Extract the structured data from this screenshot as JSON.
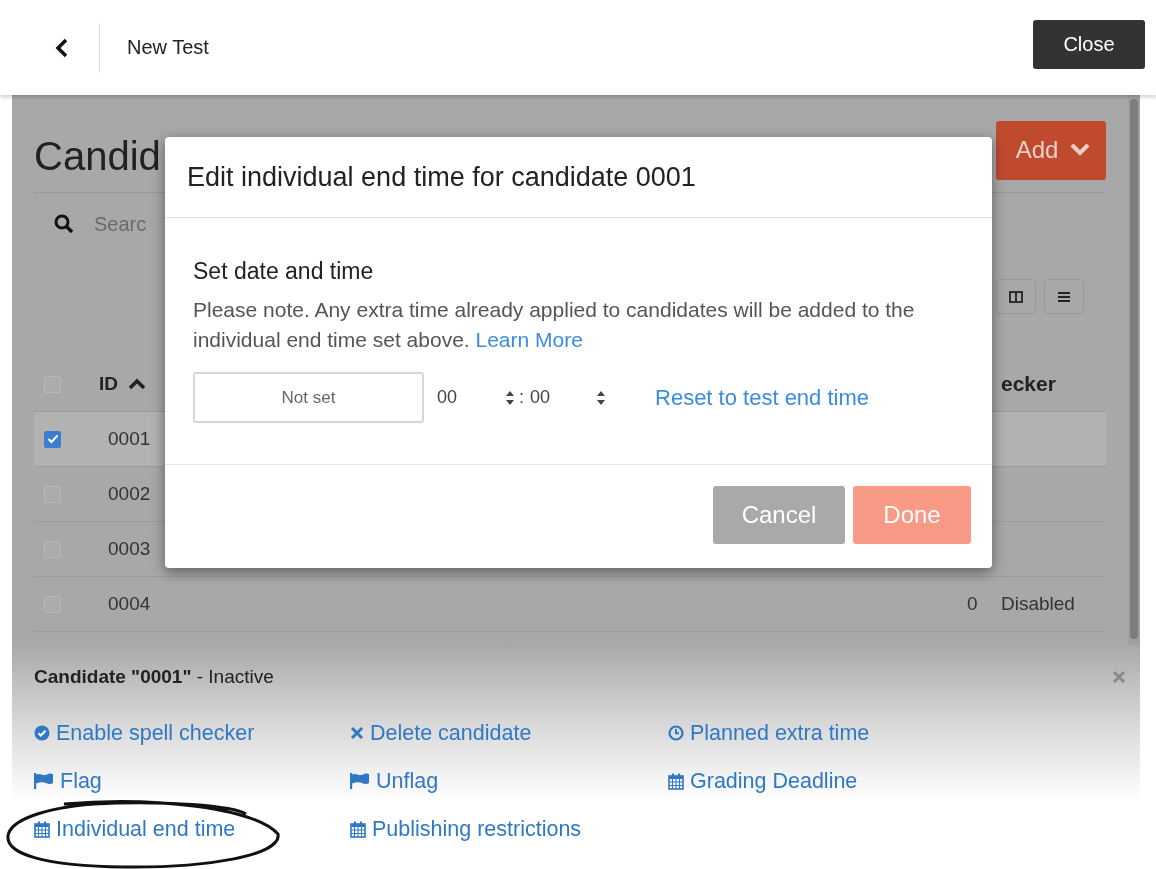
{
  "header": {
    "title": "New Test",
    "close_button": "Close"
  },
  "page": {
    "title": "Candid",
    "add_button": "Add",
    "search_placeholder": "Searc",
    "select_all": {
      "checked": false
    },
    "columns": [
      {
        "label": "ID",
        "sort_ascending": true
      },
      {
        "label": "ecker"
      }
    ],
    "rows": [
      {
        "id": "0001",
        "checked": true
      },
      {
        "id": "0002",
        "checked": false
      },
      {
        "id": "0003",
        "checked": false
      },
      {
        "id": "0004",
        "checked": false,
        "column_3": "0",
        "column_4": "Disabled"
      }
    ]
  },
  "modal": {
    "title": "Edit individual end time for candidate 0001",
    "section_title": "Set date and time",
    "note": "Please note. Any extra time already applied to candidates will be added to the individual end time set above.",
    "note_link": "Learn More",
    "date_field": {
      "placeholder": "Not set"
    },
    "hours": "00",
    "separator": ":",
    "minutes": "00",
    "reset_link": "Reset to test end time",
    "buttons": [
      {
        "label": "Cancel",
        "kind": "secondary",
        "disabled": false
      },
      {
        "label": "Done",
        "kind": "primary",
        "disabled": true
      }
    ]
  },
  "panel": {
    "title": "**Candidate \"0001\"** - Inactive",
    "actions": [
      {
        "label": "Enable spell checker",
        "kind": "check"
      },
      {
        "label": "Delete candidate",
        "kind": "delete"
      },
      {
        "label": "Planned extra time",
        "kind": "clock"
      },
      {
        "label": "Flag",
        "kind": "flag"
      },
      {
        "label": "Unflag",
        "kind": "flag"
      },
      {
        "label": "Grading Deadline",
        "kind": "calendar"
      },
      {
        "label": "Individual end time",
        "kind": "calendar"
      },
      {
        "label": "Publishing restrictions",
        "kind": "calendar"
      }
    ]
  }
}
